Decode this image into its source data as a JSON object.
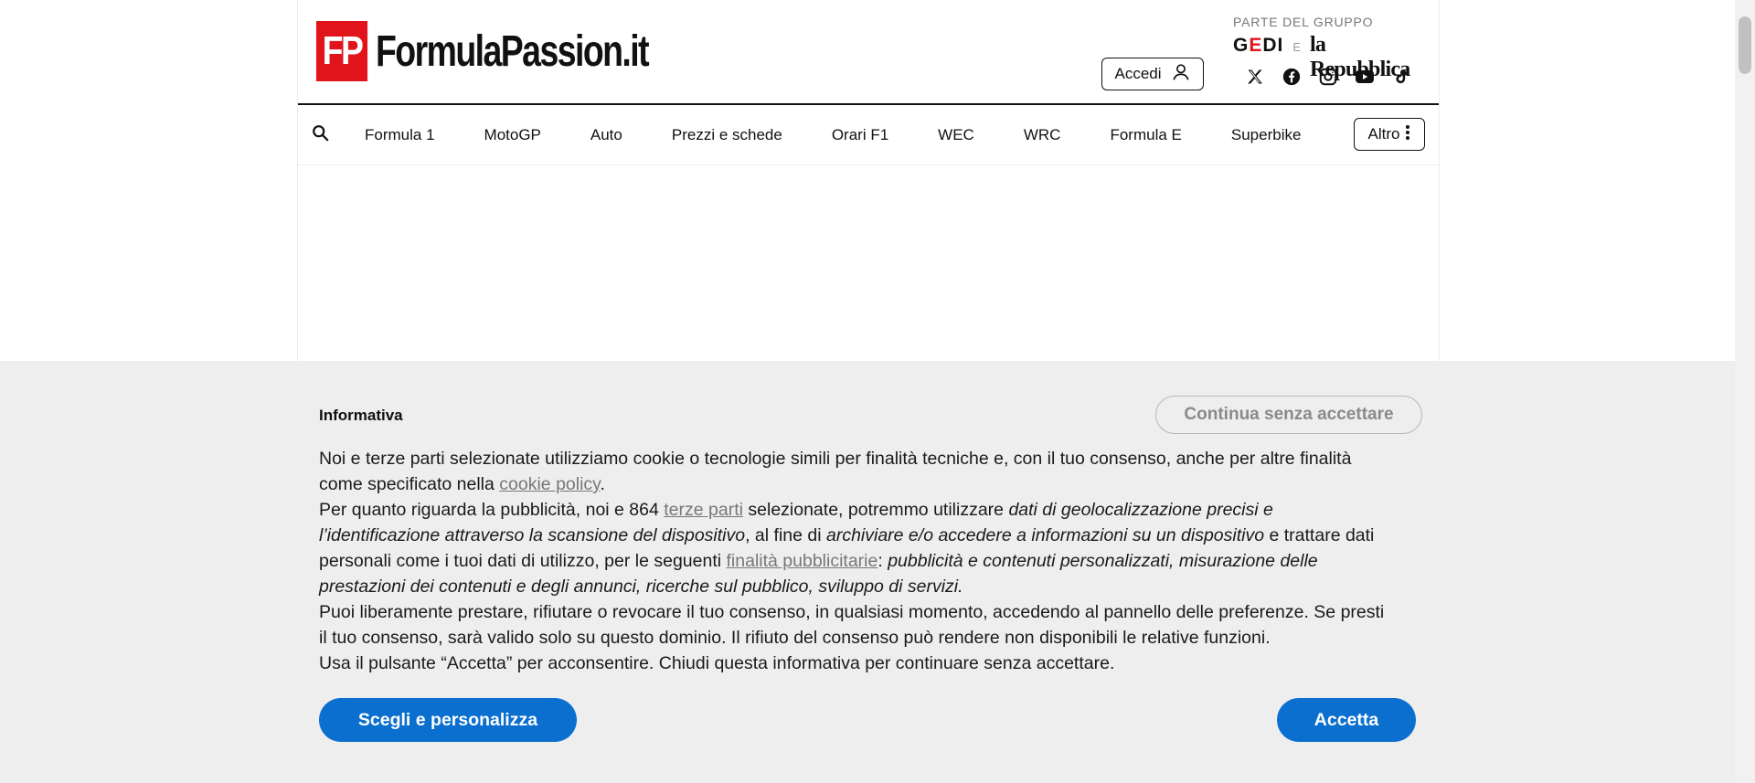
{
  "header": {
    "logo_badge": "FP",
    "logo_text": "FormulaPassion.it",
    "login_label": "Accedi",
    "group_label": "PARTE DEL GRUPPO",
    "group_gedi_prefix": "G",
    "group_gedi_accent": "E",
    "group_gedi_suffix": "DI",
    "group_separator": "E",
    "group_repubblica": "la Repubblica",
    "socials": [
      "x-icon",
      "facebook-icon",
      "instagram-icon",
      "youtube-icon",
      "tiktok-icon"
    ]
  },
  "nav": {
    "items": [
      "Formula 1",
      "MotoGP",
      "Auto",
      "Prezzi e schede",
      "Orari F1",
      "WEC",
      "WRC",
      "Formula E",
      "Superbike"
    ],
    "more_label": "Altro"
  },
  "consent": {
    "title": "Informativa",
    "continue_label": "Continua senza accettare",
    "p1_a": "Noi e terze parti selezionate utilizziamo cookie o tecnologie simili per finalità tecniche e, con il tuo consenso, anche per altre finalità come specificato nella ",
    "p1_link": "cookie policy",
    "p1_b": ".",
    "p2_a": "Per quanto riguarda la pubblicità, noi e 864 ",
    "p2_link1": "terze parti",
    "p2_b": " selezionate, potremmo utilizzare ",
    "p2_i1": "dati di geolocalizzazione precisi e l’identificazione attraverso la scansione del dispositivo",
    "p2_c": ", al fine di ",
    "p2_i2": "archiviare e/o accedere a informazioni su un dispositivo",
    "p2_d": " e trattare dati personali come i tuoi dati di utilizzo, per le seguenti ",
    "p2_link2": "finalità pubblicitarie",
    "p2_e": ": ",
    "p2_i3": "pubblicità e contenuti personalizzati, misurazione delle prestazioni dei contenuti e degli annunci, ricerche sul pubblico, sviluppo di servizi.",
    "p3": "Puoi liberamente prestare, rifiutare o revocare il tuo consenso, in qualsiasi momento, accedendo al pannello delle preferenze. Se presti il tuo consenso, sarà valido solo su questo dominio. Il rifiuto del consenso può rendere non disponibili le relative funzioni.",
    "p4": "Usa il pulsante “Accetta” per acconsentire. Chiudi questa informativa per continuare senza accettare.",
    "customize_label": "Scegli e personalizza",
    "accept_label": "Accetta"
  },
  "colors": {
    "brand_red": "#e1141b",
    "primary_blue": "#0a6fce",
    "consent_bg": "#eeeeee"
  }
}
